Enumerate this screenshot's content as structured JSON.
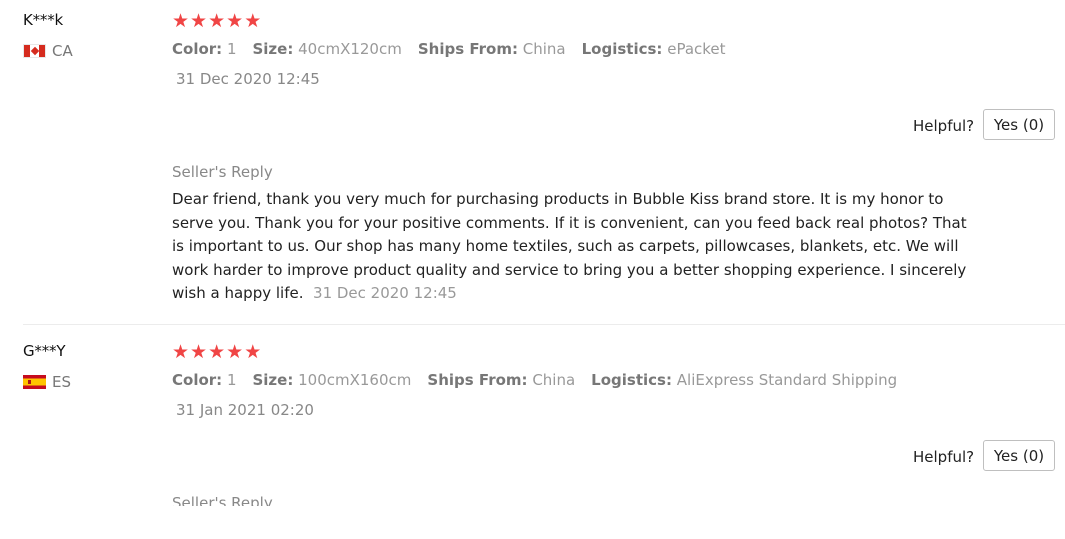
{
  "reviews": [
    {
      "user": "K***k",
      "country": "CA",
      "flag_icon": "canada-flag-icon",
      "stars": [
        "★",
        "★",
        "★",
        "★",
        "★"
      ],
      "rating": 5,
      "attributes": [
        {
          "key": "Color:",
          "value": "1"
        },
        {
          "key": "Size:",
          "value": "40cmX120cm"
        },
        {
          "key": "Ships From:",
          "value": "China"
        },
        {
          "key": "Logistics:",
          "value": "ePacket"
        }
      ],
      "date": "31 Dec 2020 12:45",
      "helpful_label": "Helpful?",
      "yes_button": "Yes (0)",
      "seller_reply_title": "Seller's Reply",
      "seller_reply_text": "Dear friend, thank you very much for purchasing products in Bubble Kiss brand store. It is my honor to serve you. Thank you for your positive comments. If it is convenient, can you feed back real photos? That is important to us. Our shop has many home textiles, such as carpets, pillowcases, blankets, etc. We will work harder to improve product quality and service to bring you a better shopping experience. I sincerely wish a happy life.",
      "seller_reply_date": "31 Dec 2020 12:45"
    },
    {
      "user": "G***Y",
      "country": "ES",
      "flag_icon": "spain-flag-icon",
      "stars": [
        "★",
        "★",
        "★",
        "★",
        "★"
      ],
      "rating": 5,
      "attributes": [
        {
          "key": "Color:",
          "value": "1"
        },
        {
          "key": "Size:",
          "value": "100cmX160cm"
        },
        {
          "key": "Ships From:",
          "value": "China"
        },
        {
          "key": "Logistics:",
          "value": "AliExpress Standard Shipping"
        }
      ],
      "date": "31 Jan 2021 02:20",
      "helpful_label": "Helpful?",
      "yes_button": "Yes (0)",
      "seller_reply_title": "Seller's Reply"
    }
  ],
  "colors": {
    "star": "#f04545",
    "muted_text": "#999999",
    "divider": "#ececec"
  }
}
